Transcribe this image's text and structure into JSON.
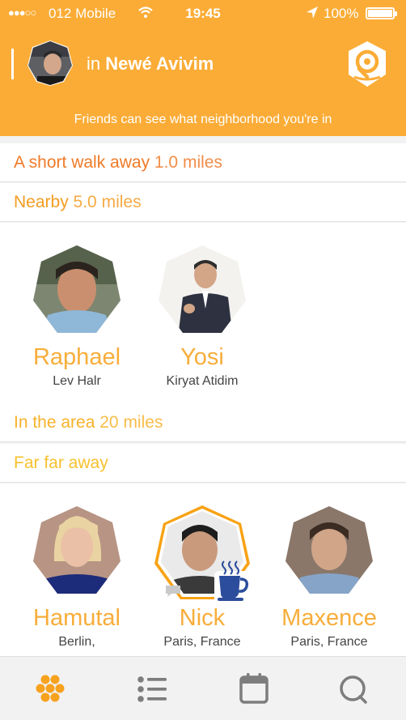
{
  "status_bar": {
    "signal": "●●●○○",
    "carrier": "012 Mobile",
    "time": "19:45",
    "battery": "100%"
  },
  "header": {
    "in_prefix": "in ",
    "neighborhood": "Newé Avivim",
    "subtitle": "Friends can see what neighborhood you're in"
  },
  "sections": {
    "short_walk": {
      "label": "A short walk away",
      "distance": "1.0 miles",
      "color": "#f07a28"
    },
    "nearby": {
      "label": "Nearby",
      "distance": "5.0 miles",
      "color": "#f49c22"
    },
    "in_area": {
      "label": "In the area",
      "distance": "20 miles",
      "color": "#f7b22b"
    },
    "far_away": {
      "label": "Far far away",
      "distance": "",
      "color": "#f6c12d"
    }
  },
  "nearby_people": [
    {
      "name": "Raphael",
      "location": "Lev Halr"
    },
    {
      "name": "Yosi",
      "location": "Kiryat Atidim"
    }
  ],
  "far_people": [
    {
      "name": "Hamutal",
      "location": "Berlin,"
    },
    {
      "name": "Nick",
      "location": "Paris, France"
    },
    {
      "name": "Maxence",
      "location": "Paris, France"
    }
  ],
  "colors": {
    "header_bg": "#fbac36",
    "name_color": "#f7ad3a",
    "tab_active": "#f7a21e",
    "tab_inactive": "#7d7d7d"
  },
  "icons": {
    "wifi": "wifi-icon",
    "location_arrow": "location-arrow-icon",
    "battery": "battery-icon",
    "locate": "locate-pin-icon",
    "coffee": "coffee-cup-icon",
    "chat": "chat-bubble-icon",
    "tabs": [
      "hexagon-cluster-icon",
      "list-icon",
      "calendar-icon",
      "chat-icon"
    ]
  }
}
